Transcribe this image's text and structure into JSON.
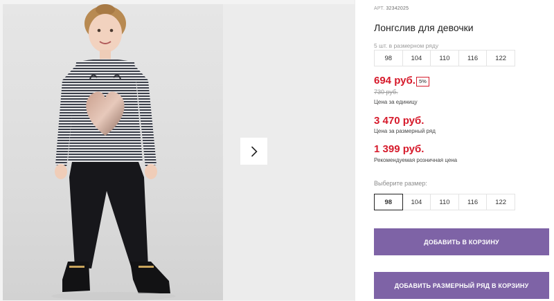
{
  "gallery": {
    "next_icon": "chevron-right-icon",
    "background": "#f3f3f3"
  },
  "product": {
    "article_label": "АРТ.",
    "article_number": "32342025",
    "title": "Лонгслив для девочки",
    "pack_note": "5 шт. в размерном ряду",
    "pack_sizes": [
      "98",
      "104",
      "110",
      "116",
      "122"
    ]
  },
  "pricing": {
    "unit_price": "694 руб.",
    "discount": "5%",
    "old_price": "730 руб.",
    "unit_caption": "Цена за единицу",
    "set_price": "3 470 руб.",
    "set_caption": "Цена за размерный ряд",
    "rrp_price": "1 399 руб.",
    "rrp_caption": "Рекомендуемая розничная цена",
    "price_color": "#d61a2b"
  },
  "size_selector": {
    "label": "Выберите размер:",
    "options": [
      "98",
      "104",
      "110",
      "116",
      "122"
    ],
    "selected": "98"
  },
  "actions": {
    "add_to_cart": "ДОБАВИТЬ В КОРЗИНУ",
    "add_set_to_cart": "ДОБАВИТЬ РАЗМЕРНЫЙ РЯД В КОРЗИНУ",
    "button_color": "#7e63a6"
  }
}
